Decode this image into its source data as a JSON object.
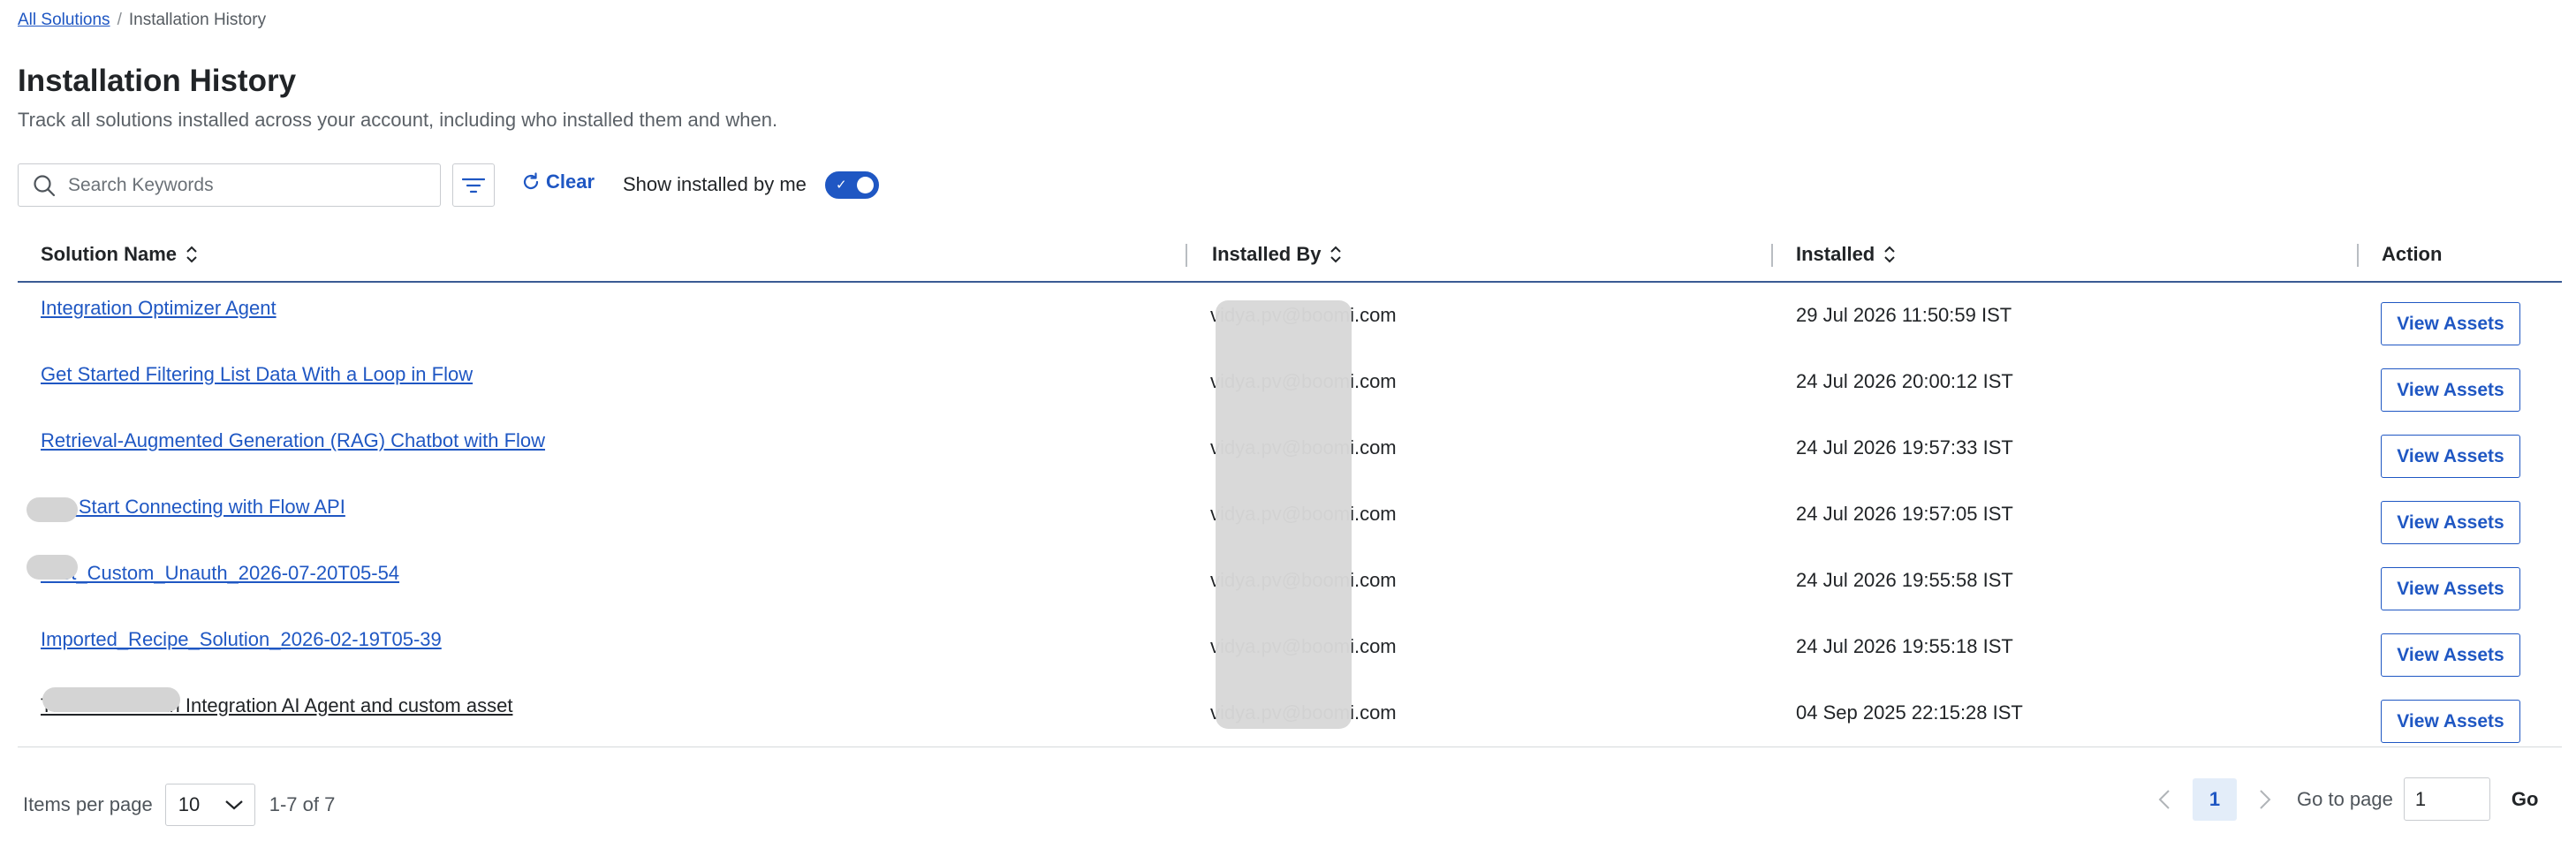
{
  "breadcrumb": {
    "root": "All Solutions",
    "separator": "/",
    "current": "Installation History"
  },
  "header": {
    "title": "Installation History",
    "subtitle": "Track all solutions installed across your account, including who installed them and when."
  },
  "toolbar": {
    "search_placeholder": "Search Keywords",
    "clear_label": "Clear",
    "toggle_label": "Show installed by me",
    "toggle_on": true
  },
  "table": {
    "columns": [
      "Solution Name",
      "Installed By",
      "Installed",
      "Action"
    ],
    "rows": [
      {
        "name": "Integration Optimizer Agent",
        "installed_by": "vidya.pv@boomi.com",
        "installed": "29 Jul 2026 11:50:59 IST",
        "action": "View Assets"
      },
      {
        "name": "Get Started Filtering List Data With a Loop in Flow",
        "installed_by": "vidya.pv@boomi.com",
        "installed": "24 Jul 2026 20:00:12 IST",
        "action": "View Assets"
      },
      {
        "name": "Retrieval-Augmented Generation (RAG) Chatbot with Flow",
        "installed_by": "vidya.pv@boomi.com",
        "installed": "24 Jul 2026 19:57:33 IST",
        "action": "View Assets"
      },
      {
        "name": "001 Start Connecting with Flow API",
        "installed_by": "vidya.pv@boomi.com",
        "installed": "24 Jul 2026 19:57:05 IST",
        "action": "View Assets"
      },
      {
        "name": "Test_Custom_Unauth_2026-07-20T05-54",
        "installed_by": "vidya.pv@boomi.com",
        "installed": "24 Jul 2026 19:55:58 IST",
        "action": "View Assets"
      },
      {
        "name": "Imported_Recipe_Solution_2026-02-19T05-39",
        "installed_by": "vidya.pv@boomi.com",
        "installed": "24 Jul 2026 19:55:18 IST",
        "action": "View Assets"
      },
      {
        "name": "Test bundle with Integration AI Agent and custom asset",
        "installed_by": "vidya.pv@boomi.com",
        "installed": "04 Sep 2025 22:15:28 IST",
        "action": "View Assets"
      }
    ]
  },
  "pagination": {
    "items_per_page_label": "Items per page",
    "items_per_page": "10",
    "range": "1-7 of 7",
    "current_page": "1",
    "goto_label": "Go to page",
    "goto_value": "1",
    "go_label": "Go"
  },
  "colors": {
    "accent": "#1f57c3",
    "header_rule": "#3a5a94",
    "redaction": "#d8d8d8"
  }
}
